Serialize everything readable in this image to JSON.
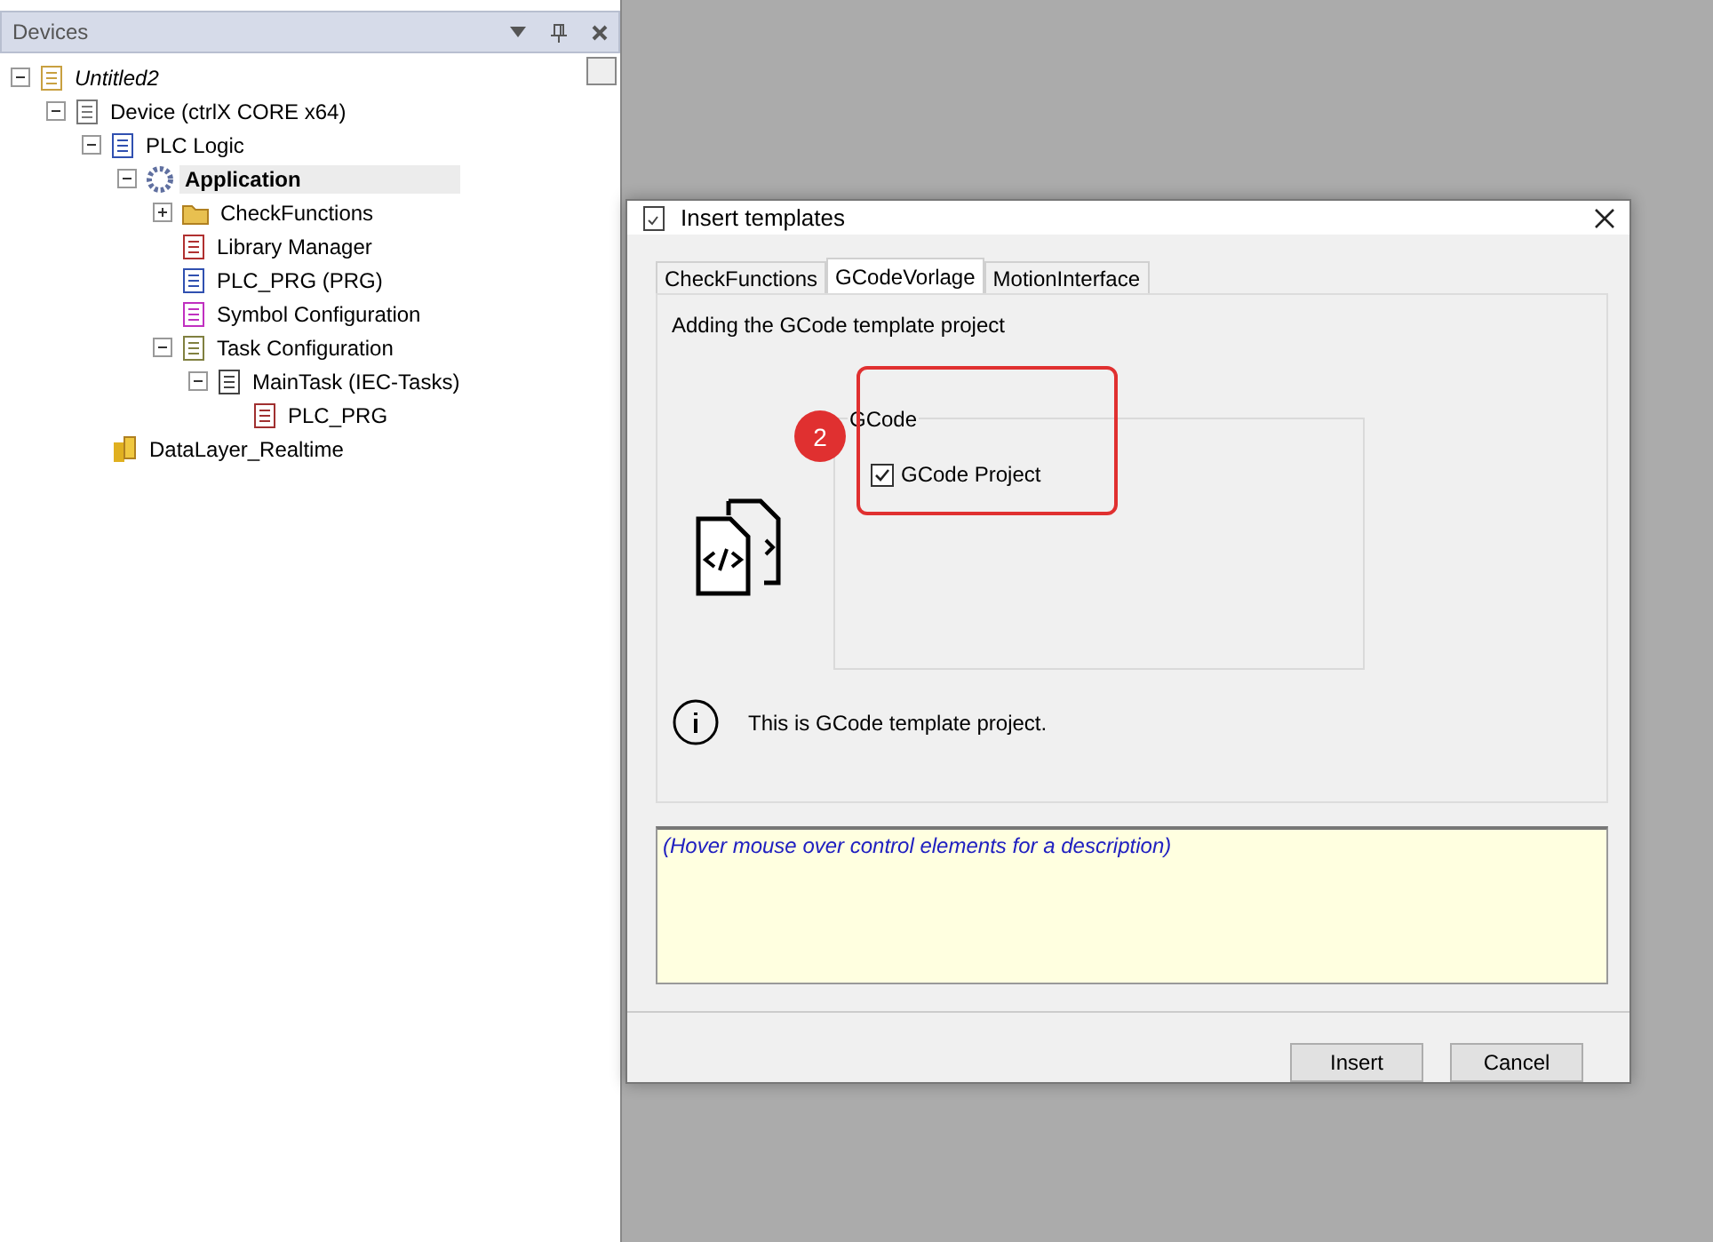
{
  "devices_panel": {
    "title": "Devices",
    "tree": [
      {
        "label": "Untitled2",
        "kind": "project",
        "italic": true,
        "expanded": true,
        "selected": false,
        "children": [
          {
            "label": "Device (ctrlX CORE x64)",
            "kind": "device",
            "expanded": true,
            "selected": false,
            "children": [
              {
                "label": "PLC Logic",
                "kind": "plc",
                "expanded": true,
                "selected": false,
                "children": [
                  {
                    "label": "Application",
                    "kind": "application",
                    "expanded": true,
                    "selected": true,
                    "children": [
                      {
                        "label": "CheckFunctions",
                        "kind": "folder",
                        "expanded": false,
                        "selected": false
                      },
                      {
                        "label": "Library Manager",
                        "kind": "library",
                        "selected": false
                      },
                      {
                        "label": "PLC_PRG (PRG)",
                        "kind": "program",
                        "selected": false
                      },
                      {
                        "label": "Symbol Configuration",
                        "kind": "symbols",
                        "selected": false
                      },
                      {
                        "label": "Task Configuration",
                        "kind": "tasks",
                        "expanded": true,
                        "selected": false,
                        "children": [
                          {
                            "label": "MainTask (IEC-Tasks)",
                            "kind": "task",
                            "expanded": true,
                            "selected": false,
                            "children": [
                              {
                                "label": "PLC_PRG",
                                "kind": "call",
                                "selected": false
                              }
                            ]
                          }
                        ]
                      }
                    ]
                  }
                ]
              },
              {
                "label": "DataLayer_Realtime",
                "kind": "datalayer",
                "selected": false
              }
            ]
          }
        ]
      }
    ]
  },
  "dialog": {
    "title": "Insert templates",
    "tabs": [
      {
        "label": "CheckFunctions",
        "selected": false
      },
      {
        "label": "GCodeVorlage",
        "selected": true
      },
      {
        "label": "MotionInterface",
        "selected": false
      }
    ],
    "heading": "Adding the GCode template project",
    "group": {
      "title": "GCode",
      "checkbox": {
        "label": "GCode Project",
        "checked": true
      }
    },
    "info": "This is GCode template project.",
    "description": "(Hover mouse over control elements for a description)",
    "buttons": [
      "Insert",
      "Cancel"
    ],
    "annotation": {
      "badge": "2"
    }
  }
}
